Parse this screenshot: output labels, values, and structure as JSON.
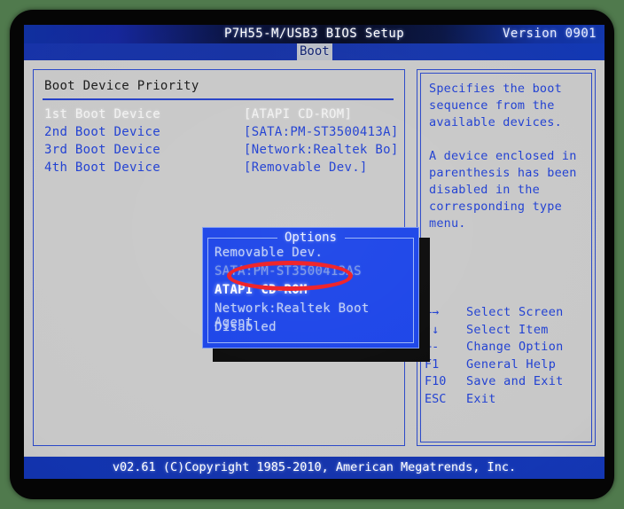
{
  "window": {
    "title": "P7H55-M/USB3 BIOS Setup",
    "version": "Version 0901"
  },
  "tabs": [
    {
      "label": "Boot",
      "active": true
    }
  ],
  "left_pane": {
    "section_title": "Boot Device Priority",
    "rows": [
      {
        "label": "1st Boot Device",
        "value": "[ATAPI CD-ROM]",
        "selected": true
      },
      {
        "label": "2nd Boot Device",
        "value": "[SATA:PM-ST3500413A]",
        "selected": false
      },
      {
        "label": "3rd Boot Device",
        "value": "[Network:Realtek Bo]",
        "selected": false
      },
      {
        "label": "4th Boot Device",
        "value": "[Removable Dev.]",
        "selected": false
      }
    ]
  },
  "right_pane": {
    "help_text": "Specifies the boot\nsequence from the\navailable devices.\n\nA device enclosed in\nparenthesis has been\ndisabled in the\ncorresponding type\nmenu.",
    "key_legend": [
      {
        "glyph": "←→",
        "desc": "Select Screen"
      },
      {
        "glyph": "↑↓",
        "desc": "Select Item"
      },
      {
        "glyph": "+-",
        "desc": "Change Option"
      },
      {
        "glyph": "F1",
        "desc": "General Help"
      },
      {
        "glyph": "F10",
        "desc": "Save and Exit"
      },
      {
        "glyph": "ESC",
        "desc": "Exit"
      }
    ]
  },
  "options_popup": {
    "title": "Options",
    "items": [
      {
        "label": "Removable Dev.",
        "state": "normal"
      },
      {
        "label": "SATA:PM-ST3500413AS",
        "state": "dim"
      },
      {
        "label": "ATAPI CD-ROM",
        "state": "highlight"
      },
      {
        "label": "Network:Realtek Boot Agent",
        "state": "normal"
      },
      {
        "label": "Disabled",
        "state": "normal"
      }
    ]
  },
  "annotation": {
    "shape": "ellipse",
    "color": "#ee1c23",
    "targets": "Removable Dev."
  },
  "footer": {
    "text": "v02.61 (C)Copyright 1985-2010, American Megatrends, Inc."
  },
  "colors": {
    "screen_background": "#c8c8c8",
    "text_blue": "#1f3fd2",
    "titlebar_blue": "#1433ab",
    "popup_blue": "#1a43e8",
    "annotation_red": "#ee1c23",
    "bezel_black": "#050505",
    "backdrop_green": "#507a4d"
  }
}
